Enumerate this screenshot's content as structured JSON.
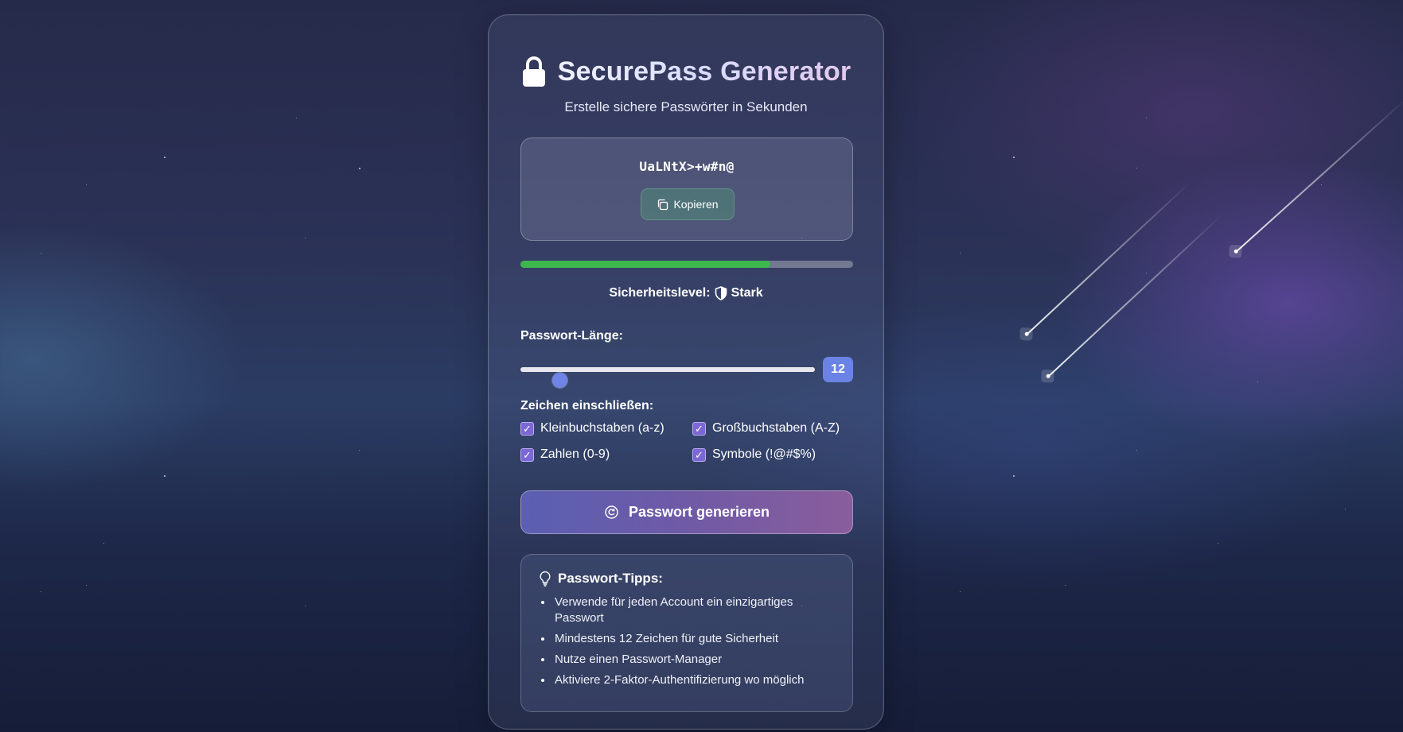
{
  "app": {
    "title": "SecurePass Generator",
    "subtitle": "Erstelle sichere Passwörter in Sekunden",
    "title_icon": "lock-icon"
  },
  "password": {
    "value": "UaLNtX>+w#n@",
    "copy_label": "Kopieren",
    "copy_icon": "copy-icon"
  },
  "strength": {
    "label": "Sicherheitslevel:",
    "level": "Stark",
    "icon": "shield-icon",
    "fill_fraction": 0.75,
    "color": "#3cb64d"
  },
  "length": {
    "label": "Passwort-Länge:",
    "value": "12",
    "min": 4,
    "max": 64
  },
  "characters": {
    "label": "Zeichen einschließen:",
    "options": [
      {
        "label": "Kleinbuchstaben (a-z)",
        "checked": true
      },
      {
        "label": "Großbuchstaben (A-Z)",
        "checked": true
      },
      {
        "label": "Zahlen (0-9)",
        "checked": true
      },
      {
        "label": "Symbole (!@#$%)",
        "checked": true
      }
    ]
  },
  "generate": {
    "label": "Passwort generieren",
    "icon": "refresh-icon"
  },
  "tips": {
    "title": "Passwort-Tipps:",
    "icon": "lightbulb-icon",
    "items": [
      "Verwende für jeden Account ein einzigartiges Passwort",
      "Mindestens 12 Zeichen für gute Sicherheit",
      "Nutze einen Passwort-Manager",
      "Aktiviere 2-Faktor-Authentifizierung wo möglich"
    ]
  },
  "colors": {
    "accent": "#6c83e6",
    "checkbox": "#7b68d6",
    "generate_gradient_start": "#5b5fb2",
    "generate_gradient_end": "#8a5d9c"
  }
}
